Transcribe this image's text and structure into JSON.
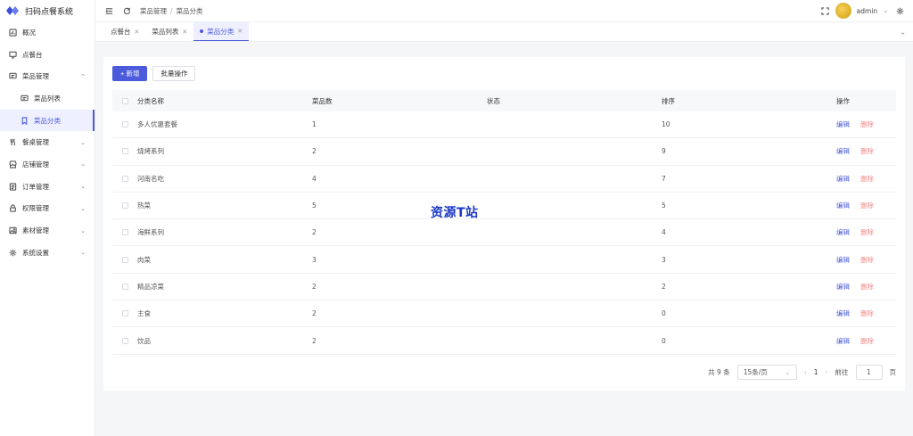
{
  "app": {
    "name": "扫码点餐系统"
  },
  "sidebar": {
    "items": [
      {
        "label": "概况",
        "icon": "dashboard-icon",
        "key": "overview"
      },
      {
        "label": "点餐台",
        "icon": "monitor-icon",
        "key": "order-desk"
      },
      {
        "label": "菜品管理",
        "icon": "message-icon",
        "key": "dish-mgmt",
        "expanded": true
      },
      {
        "label": "菜品列表",
        "icon": "message-icon",
        "key": "dish-list",
        "sub": true
      },
      {
        "label": "菜品分类",
        "icon": "bookmark-icon",
        "key": "dish-category",
        "sub": true,
        "active": true
      },
      {
        "label": "餐桌管理",
        "icon": "fork-knife-icon",
        "key": "table-mgmt"
      },
      {
        "label": "店铺管理",
        "icon": "store-icon",
        "key": "store-mgmt"
      },
      {
        "label": "订单管理",
        "icon": "order-icon",
        "key": "order-mgmt"
      },
      {
        "label": "权限管理",
        "icon": "lock-icon",
        "key": "perm-mgmt"
      },
      {
        "label": "素材管理",
        "icon": "image-icon",
        "key": "material-mgmt"
      },
      {
        "label": "系统设置",
        "icon": "gear-icon",
        "key": "settings"
      }
    ]
  },
  "header": {
    "breadcrumb": [
      "菜品管理",
      "菜品分类"
    ],
    "breadcrumb_sep": "/",
    "user": "admin"
  },
  "tabs": [
    {
      "label": "点餐台"
    },
    {
      "label": "菜品列表"
    },
    {
      "label": "菜品分类",
      "active": true
    }
  ],
  "toolbar": {
    "add_label": "+ 新增",
    "batch_label": "批量操作"
  },
  "table": {
    "columns": {
      "name": "分类名称",
      "count": "菜品数",
      "status": "状态",
      "sort": "排序",
      "op": "操作"
    },
    "edit_label": "编辑",
    "delete_label": "删除",
    "rows": [
      {
        "name": "多人优惠套餐",
        "count": "1",
        "enabled": true,
        "sort": "10"
      },
      {
        "name": "烧烤系列",
        "count": "2",
        "enabled": true,
        "sort": "9"
      },
      {
        "name": "河南名吃",
        "count": "4",
        "enabled": true,
        "sort": "7"
      },
      {
        "name": "热菜",
        "count": "5",
        "enabled": true,
        "sort": "5"
      },
      {
        "name": "海鲜系列",
        "count": "2",
        "enabled": true,
        "sort": "4"
      },
      {
        "name": "肉菜",
        "count": "3",
        "enabled": true,
        "sort": "3"
      },
      {
        "name": "精品凉菜",
        "count": "2",
        "enabled": true,
        "sort": "2"
      },
      {
        "name": "主食",
        "count": "2",
        "enabled": true,
        "sort": "0"
      },
      {
        "name": "饮品",
        "count": "2",
        "enabled": true,
        "sort": "0"
      }
    ]
  },
  "pagination": {
    "total_text": "共 9 条",
    "page_size": "15条/页",
    "current_page": "1",
    "goto_prefix": "前往",
    "goto_value": "1",
    "goto_suffix": "页"
  },
  "watermark": "资源T站",
  "colors": {
    "primary": "#4b5bdb",
    "danger": "#f08a8a"
  }
}
